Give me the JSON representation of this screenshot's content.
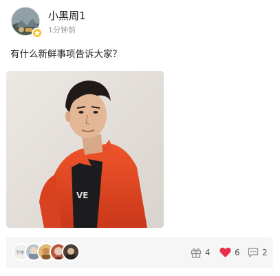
{
  "post": {
    "author": "小黑周1",
    "time": "1分钟前",
    "text": "有什么新鲜事项告诉大家？"
  },
  "icons": {
    "badge": "vip-star-icon",
    "gift": "gift-icon",
    "like": "heart-icon",
    "comment": "comment-icon"
  },
  "stats": {
    "gifts": "4",
    "likes": "6",
    "comments": "2"
  },
  "colors": {
    "like_active": "#e8304a",
    "badge": "#f6c12b",
    "jacket": "#e2461f"
  }
}
